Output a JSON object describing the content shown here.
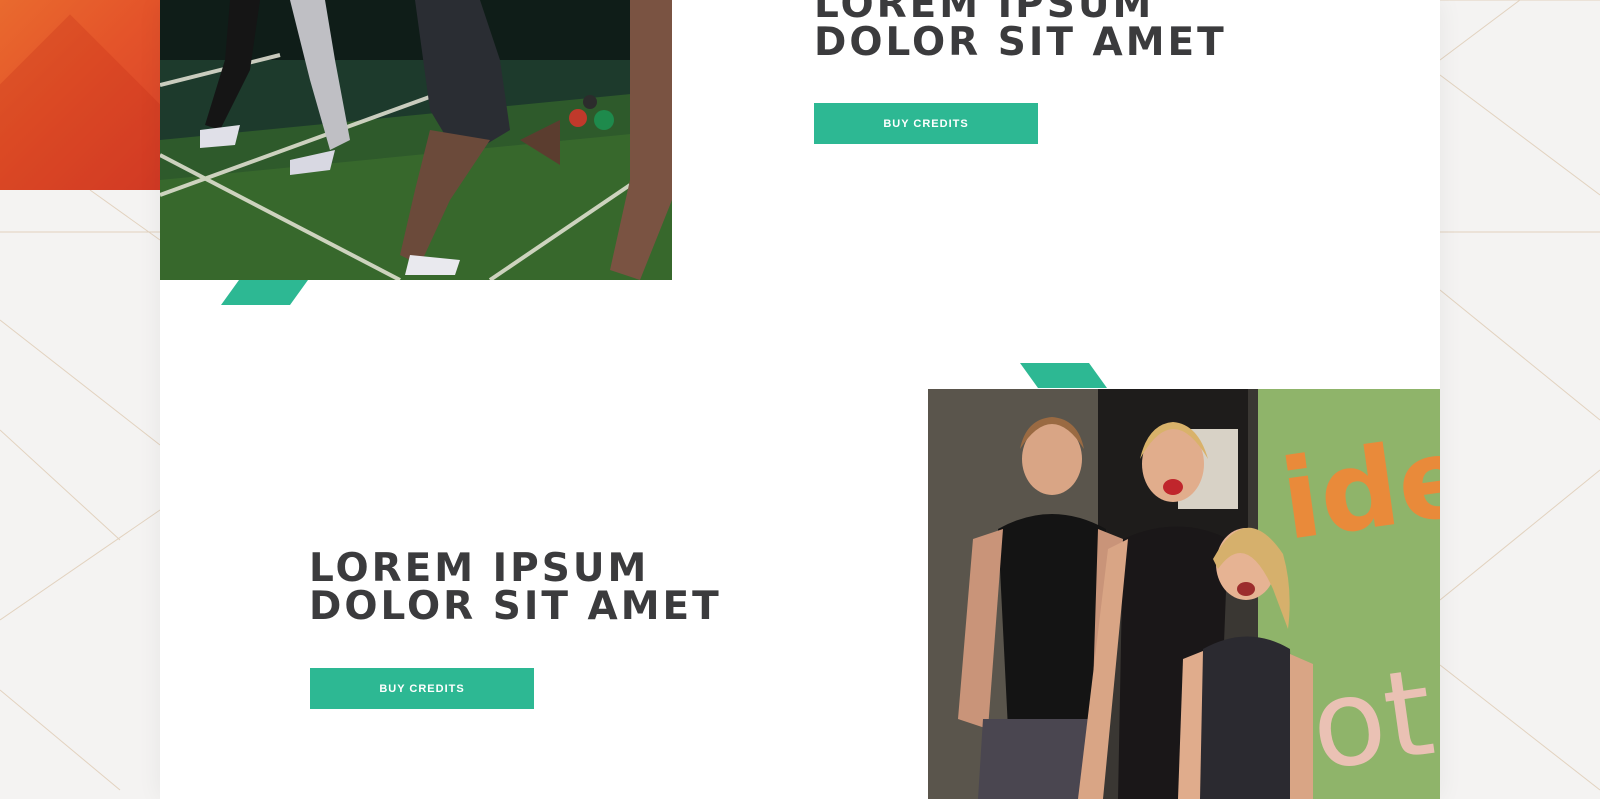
{
  "sections": [
    {
      "heading_line1": "LOREM IPSUM",
      "heading_line2": "DOLOR SIT AMET",
      "button_label": "BUY CREDITS",
      "image_icon": "gym-class-photo"
    },
    {
      "heading_line1": "LOREM IPSUM",
      "heading_line2": "DOLOR SIT AMET",
      "button_label": "BUY CREDITS",
      "image_icon": "women-smiling-photo"
    }
  ],
  "colors": {
    "accent": "#2db893",
    "heading": "#3b3b3d",
    "brand_orange": "#e4542a",
    "background": "#f4f3f2",
    "card": "#ffffff"
  }
}
